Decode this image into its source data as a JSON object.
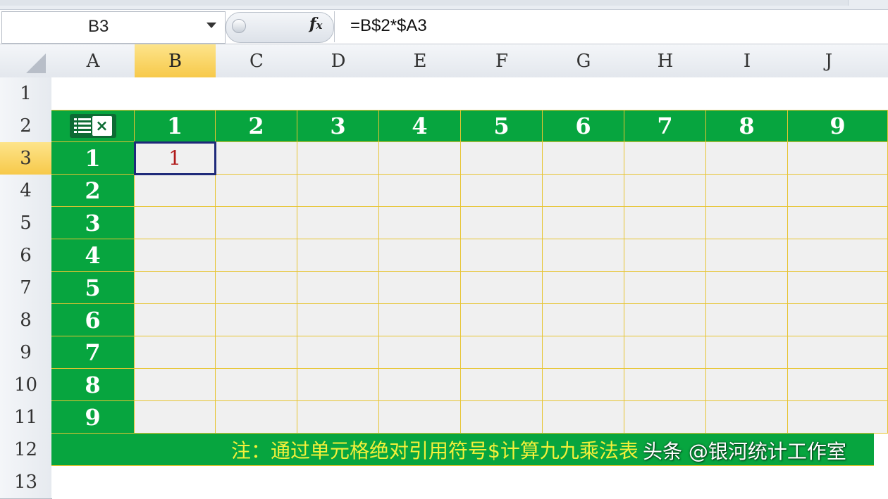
{
  "formula_bar": {
    "name_box": "B3",
    "fx_label": "fx",
    "formula": "=B$2*$A3"
  },
  "columns": [
    "A",
    "B",
    "C",
    "D",
    "E",
    "F",
    "G",
    "H",
    "I",
    "J"
  ],
  "active_column": "B",
  "rows": [
    "1",
    "2",
    "3",
    "4",
    "5",
    "6",
    "7",
    "8",
    "9",
    "10",
    "11",
    "12",
    "13"
  ],
  "active_row": "3",
  "table": {
    "header_row": [
      "1",
      "2",
      "3",
      "4",
      "5",
      "6",
      "7",
      "8",
      "9"
    ],
    "header_col": [
      "1",
      "2",
      "3",
      "4",
      "5",
      "6",
      "7",
      "8",
      "9"
    ],
    "cell_B3": "1",
    "corner_logo": "excel-logo-icon"
  },
  "note": "注：通过单元格绝对引用符号$计算九九乘法表",
  "watermark": "头条 @银河统计工作室",
  "colors": {
    "green": "#07a53f",
    "grid_line": "#e7c430",
    "note_text": "#f3f03a",
    "cell_value": "#b01a1a",
    "active_header": "#f7c94a"
  }
}
